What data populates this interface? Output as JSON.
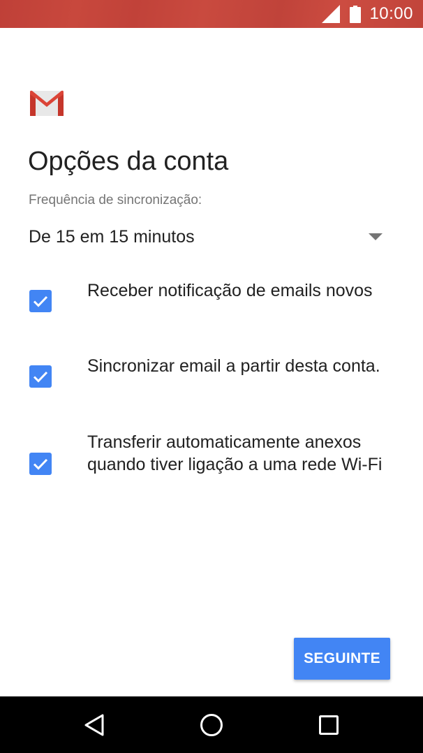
{
  "status_bar": {
    "time": "10:00",
    "background": "#c1443a",
    "icons": [
      "signal-icon",
      "battery-icon"
    ]
  },
  "header": {
    "logo": "gmail-logo",
    "title": "Opções da conta"
  },
  "sync": {
    "label": "Frequência de sincronização:",
    "selected": "De 15 em 15 minutos"
  },
  "options": [
    {
      "label": "Receber notificação de emails novos",
      "checked": true
    },
    {
      "label": "Sincronizar email a partir desta conta.",
      "checked": true
    },
    {
      "label": "Transferir automaticamente anexos quando tiver ligação a uma rede Wi-Fi",
      "checked": true
    }
  ],
  "button": {
    "label": "SEGUINTE"
  },
  "nav_bar": {
    "icons": [
      "back-icon",
      "home-icon",
      "recents-icon"
    ]
  },
  "colors": {
    "accent": "#4285f4",
    "status_bar": "#c1443a",
    "text_primary": "#212121",
    "text_secondary": "#757575"
  }
}
